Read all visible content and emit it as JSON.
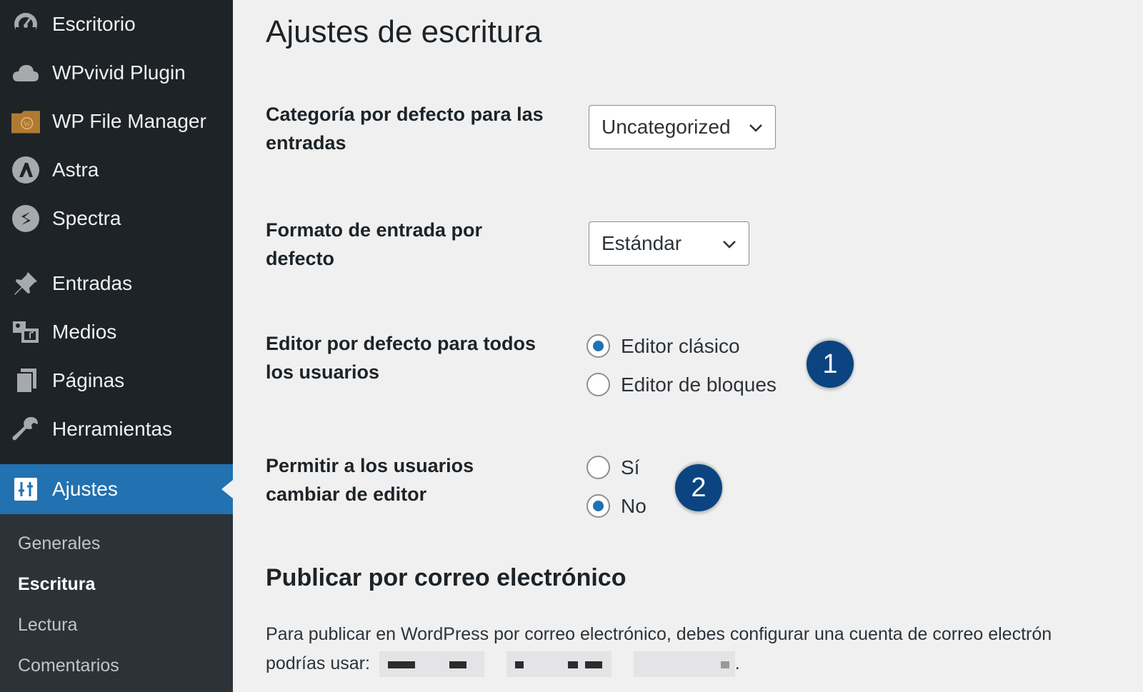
{
  "sidebar": {
    "items": [
      {
        "label": "Escritorio",
        "icon": "dashboard-icon"
      },
      {
        "label": "WPvivid Plugin",
        "icon": "cloud-icon"
      },
      {
        "label": "WP File Manager",
        "icon": "folder-icon"
      },
      {
        "label": "Astra",
        "icon": "astra-icon"
      },
      {
        "label": "Spectra",
        "icon": "spectra-icon"
      },
      {
        "label": "Entradas",
        "icon": "pin-icon"
      },
      {
        "label": "Medios",
        "icon": "media-icon"
      },
      {
        "label": "Páginas",
        "icon": "pages-icon"
      },
      {
        "label": "Herramientas",
        "icon": "wrench-icon"
      },
      {
        "label": "Ajustes",
        "icon": "settings-icon",
        "active": true
      }
    ],
    "submenu": [
      {
        "label": "Generales"
      },
      {
        "label": "Escritura",
        "current": true
      },
      {
        "label": "Lectura"
      },
      {
        "label": "Comentarios"
      }
    ]
  },
  "main": {
    "title": "Ajustes de escritura",
    "default_category": {
      "label": "Categoría por defecto para las entradas",
      "value": "Uncategorized"
    },
    "default_format": {
      "label": "Formato de entrada por defecto",
      "value": "Estándar"
    },
    "default_editor": {
      "label": "Editor por defecto para todos los usuarios",
      "options": [
        "Editor clásico",
        "Editor de bloques"
      ],
      "selected": "Editor clásico"
    },
    "allow_switch": {
      "label": "Permitir a los usuarios cambiar de editor",
      "options": [
        "Sí",
        "No"
      ],
      "selected": "No"
    },
    "badges": [
      "1",
      "2"
    ],
    "email_section": {
      "title": "Publicar por correo electrónico",
      "text_line1": "Para publicar en WordPress por correo electrónico, debes configurar una cuenta de correo electrón",
      "text_line2_prefix": "podrías usar:",
      "text_line2_suffix": "."
    }
  },
  "colors": {
    "sidebar_bg": "#1d2327",
    "active_bg": "#2271b1",
    "badge_bg": "#0b4481",
    "page_bg": "#f0f0f1"
  }
}
